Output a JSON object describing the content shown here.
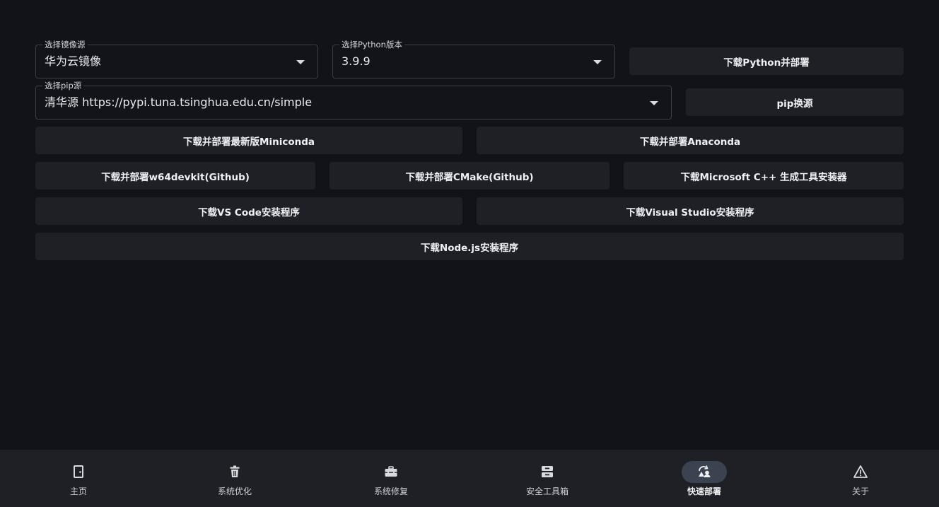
{
  "mirror_select": {
    "label": "选择镜像源",
    "value": "华为云镜像"
  },
  "python_select": {
    "label": "选择Python版本",
    "value": "3.9.9"
  },
  "pip_select": {
    "label": "选择pip源",
    "value": "清华源 https://pypi.tuna.tsinghua.edu.cn/simple"
  },
  "buttons": {
    "deploy_python": "下载Python并部署",
    "pip_switch": "pip换源",
    "miniconda": "下载并部署最新版Miniconda",
    "anaconda": "下载并部署Anaconda",
    "w64devkit": "下载并部署w64devkit(Github)",
    "cmake": "下载并部署CMake(Github)",
    "msvc_build_tools": "下载Microsoft C++ 生成工具安装器",
    "vscode": "下载VS Code安装程序",
    "visual_studio": "下载Visual Studio安装程序",
    "nodejs": "下载Node.js安装程序"
  },
  "nav": [
    {
      "label": "主页",
      "icon": "door-icon"
    },
    {
      "label": "系统优化",
      "icon": "trash-icon"
    },
    {
      "label": "系统修复",
      "icon": "toolbox-icon"
    },
    {
      "label": "安全工具箱",
      "icon": "inbox-icon"
    },
    {
      "label": "快速部署",
      "icon": "deploy-icon",
      "active": true
    },
    {
      "label": "关于",
      "icon": "warning-icon"
    }
  ],
  "colors": {
    "background": "#111318",
    "surface": "#1e2026",
    "active_pill": "#3b4250"
  }
}
